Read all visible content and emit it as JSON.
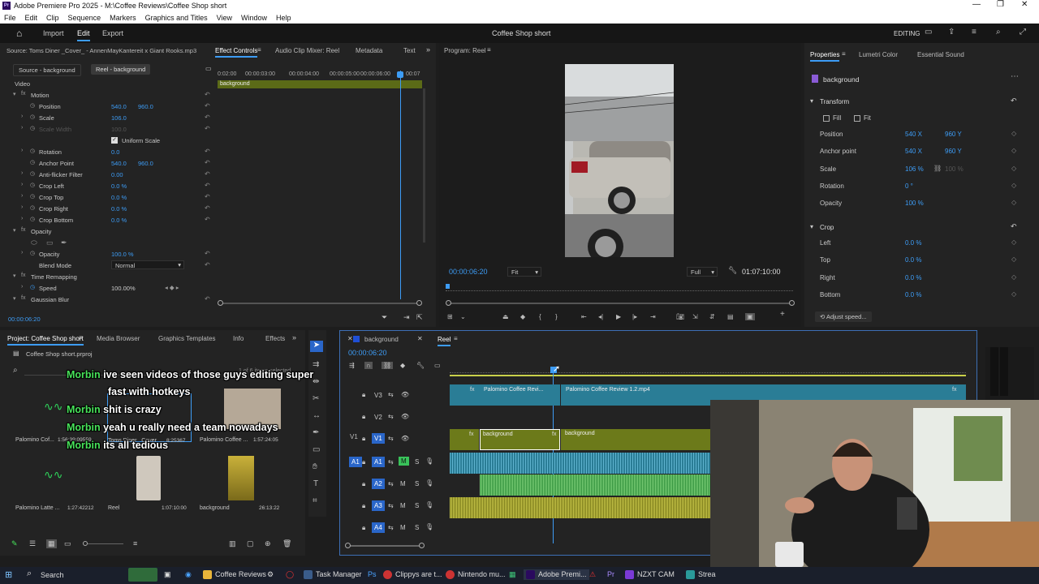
{
  "app": {
    "title": "Adobe Premiere Pro 2025 - M:\\Coffee Reviews\\Coffee Shop short",
    "menu": [
      "File",
      "Edit",
      "Clip",
      "Sequence",
      "Markers",
      "Graphics and Titles",
      "View",
      "Window",
      "Help"
    ],
    "workspace": {
      "tabs": [
        "Import",
        "Edit",
        "Export"
      ],
      "project_title": "Coffee Shop short",
      "mode": "EDITING"
    }
  },
  "effect_controls": {
    "source_tab": "Source: Toms Diner _Cover_ - AnnenMayKantereit x Giant Rooks.mp3",
    "active_tab": "Effect Controls",
    "tabs": [
      "Audio Clip Mixer: Reel",
      "Metadata",
      "Text"
    ],
    "src_btn": "Source - background",
    "reel_btn": "Reel - background",
    "ruler": [
      "0:02:00",
      "00:00:03:00",
      "00:00:04:00",
      "00:00:05:00",
      "00:00:06:00",
      "00:07"
    ],
    "clip_label": "background",
    "video_label": "Video",
    "rows": {
      "motion": "Motion",
      "position": {
        "label": "Position",
        "v1": "540.0",
        "v2": "960.0"
      },
      "scale": {
        "label": "Scale",
        "v1": "106.0"
      },
      "scale_width": {
        "label": "Scale Width",
        "v1": "100.0"
      },
      "uniform": "Uniform Scale",
      "rotation": {
        "label": "Rotation",
        "v1": "0.0"
      },
      "anchor": {
        "label": "Anchor Point",
        "v1": "540.0",
        "v2": "960.0"
      },
      "antiflicker": {
        "label": "Anti-flicker Filter",
        "v1": "0.00"
      },
      "crop_left": {
        "label": "Crop Left",
        "v1": "0.0 %"
      },
      "crop_top": {
        "label": "Crop Top",
        "v1": "0.0 %"
      },
      "crop_right": {
        "label": "Crop Right",
        "v1": "0.0 %"
      },
      "crop_bottom": {
        "label": "Crop Bottom",
        "v1": "0.0 %"
      },
      "opacity_group": "Opacity",
      "opacity": {
        "label": "Opacity",
        "v1": "100.0 %"
      },
      "blend": {
        "label": "Blend Mode",
        "v1": "Normal"
      },
      "time_remap": "Time Remapping",
      "speed": {
        "label": "Speed",
        "v1": "100.00%"
      },
      "gaussian": "Gaussian Blur"
    },
    "timecode": "00:00:06:20"
  },
  "program": {
    "title": "Program: Reel",
    "timecode": "00:00:06:20",
    "zoom": "Fit",
    "quality": "Full",
    "duration": "01:07:10:00"
  },
  "properties": {
    "tabs": [
      "Properties",
      "Lumetri Color",
      "Essential Sound"
    ],
    "clip": "background",
    "transform": "Transform",
    "fill": "Fill",
    "fit": "Fit",
    "rows": [
      {
        "label": "Position",
        "v1": "540 X",
        "v2": "960 Y"
      },
      {
        "label": "Anchor point",
        "v1": "540 X",
        "v2": "960 Y"
      },
      {
        "label": "Scale",
        "v1": "106 %",
        "v2": "100 %"
      },
      {
        "label": "Rotation",
        "v1": "0 °",
        "v2": ""
      },
      {
        "label": "Opacity",
        "v1": "100 %",
        "v2": ""
      }
    ],
    "crop": "Crop",
    "crop_rows": [
      {
        "label": "Left",
        "v1": "0.0 %"
      },
      {
        "label": "Top",
        "v1": "0.0 %"
      },
      {
        "label": "Right",
        "v1": "0.0 %"
      },
      {
        "label": "Bottom",
        "v1": "0.0 %"
      }
    ],
    "adjust_speed": "Adjust speed..."
  },
  "project": {
    "tabs": [
      "Project: Coffee Shop short",
      "Media Browser",
      "Graphics Templates",
      "Info",
      "Effects"
    ],
    "file": "Coffee Shop short.prproj",
    "selected": "1 of 6 items selected",
    "items": [
      {
        "name": "Palomino Cof...",
        "dur": "1:56:39:09559"
      },
      {
        "name": "Toms Diner _Cover_...",
        "dur": "8:25367"
      },
      {
        "name": "Palomino Coffee ...",
        "dur": "1:57:24:05"
      },
      {
        "name": "Palomino Latte ...",
        "dur": "1:27:42212"
      },
      {
        "name": "Reel",
        "dur": "1:07:10:00"
      },
      {
        "name": "background",
        "dur": "26:13:22"
      }
    ]
  },
  "timeline": {
    "tabs": [
      "background",
      "Reel"
    ],
    "timecode": "00:00:06:20",
    "clips": {
      "v3a": "Palomino Coffee Revi...",
      "v3b": "Palomino Coffee Review 1.2.mp4",
      "v1a": "background",
      "v1b": "background"
    },
    "tracks": [
      "V3",
      "V2",
      "V1",
      "A1",
      "A2",
      "A3",
      "A4"
    ],
    "src": [
      "V1",
      "A1"
    ]
  },
  "chat": [
    {
      "name": "Morbin",
      "msg": "ive seen videos of those guys editing super"
    },
    {
      "name": "",
      "msg": "fast with hotkeys"
    },
    {
      "name": "Morbin",
      "msg": "shit is crazy"
    },
    {
      "name": "Morbin",
      "msg": "yeah u really need a team nowadays"
    },
    {
      "name": "Morbin",
      "msg": "its all tedious"
    }
  ],
  "taskbar": {
    "search": "Search",
    "apps": [
      "Coffee Reviews",
      "Task Manager",
      "Clippys are t...",
      "Nintendo mu...",
      "Adobe Premi...",
      "NZXT CAM",
      "Strea"
    ]
  },
  "colors": {
    "accent": "#3d9cf5",
    "green": "#48e35a",
    "v_track": "#2a7d96",
    "v1_track": "#6c7a1a",
    "a_wave": "#2f8f3a"
  }
}
